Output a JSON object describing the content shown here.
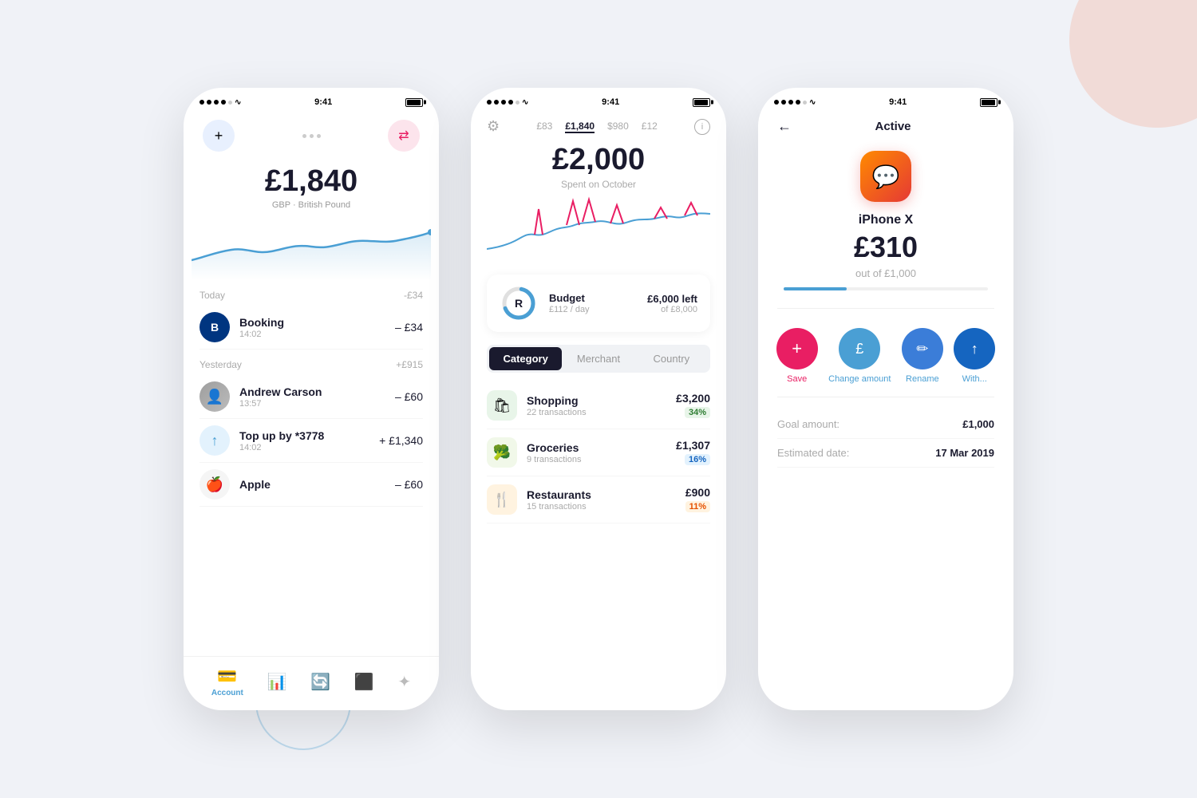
{
  "background": {
    "color": "#f0f2f7"
  },
  "phone1": {
    "status_bar": {
      "time": "9:41",
      "signal": "●●●●○",
      "wifi": "wifi"
    },
    "balance": "£1,840",
    "currency": "GBP · British Pound",
    "add_button": "+",
    "transfer_button": "⇄",
    "transactions": {
      "today_label": "Today",
      "today_amount": "-£34",
      "yesterday_label": "Yesterday",
      "yesterday_amount": "+£915",
      "items": [
        {
          "name": "Booking",
          "time": "14:02",
          "amount": "– £34",
          "avatar_text": "B",
          "avatar_type": "booking"
        },
        {
          "name": "Andrew Carson",
          "time": "13:57",
          "amount": "– £60",
          "avatar_text": "👤",
          "avatar_type": "andrew"
        },
        {
          "name": "Top up by *3778",
          "time": "14:02",
          "amount": "+ £1,340",
          "avatar_text": "↑",
          "avatar_type": "topup"
        },
        {
          "name": "Apple",
          "time": "",
          "amount": "– £60",
          "avatar_text": "🍎",
          "avatar_type": "apple"
        }
      ]
    },
    "nav": {
      "items": [
        {
          "icon": "💳",
          "label": "Account",
          "active": true
        },
        {
          "icon": "📊",
          "label": "",
          "active": false
        },
        {
          "icon": "🔄",
          "label": "",
          "active": false
        },
        {
          "icon": "⬛",
          "label": "",
          "active": false
        },
        {
          "icon": "✦",
          "label": "",
          "active": false
        }
      ]
    }
  },
  "phone2": {
    "status_bar": {
      "time": "9:41"
    },
    "header_tabs": [
      "£83",
      "£1,840",
      "$980",
      "£12"
    ],
    "balance": "£2,000",
    "balance_sub": "Spent on October",
    "budget": {
      "icon": "R",
      "label": "Budget",
      "sub": "£112 / day",
      "left": "£6,000 left",
      "of": "of £8,000"
    },
    "segment_tabs": [
      "Category",
      "Merchant",
      "Country"
    ],
    "active_tab": "Category",
    "categories": [
      {
        "icon": "🛍",
        "type": "shopping",
        "name": "Shopping",
        "count": "22 transactions",
        "amount": "£3,200",
        "pct": "34%",
        "pct_type": "green"
      },
      {
        "icon": "🥦",
        "type": "groceries",
        "name": "Groceries",
        "count": "9 transactions",
        "amount": "£1,307",
        "pct": "16%",
        "pct_type": "blue"
      },
      {
        "icon": "🍴",
        "type": "restaurants",
        "name": "Restaurants",
        "count": "15 transactions",
        "amount": "£900",
        "pct": "11%",
        "pct_type": "orange"
      }
    ]
  },
  "phone3": {
    "status_bar": {
      "time": "9:41"
    },
    "back_label": "←",
    "title": "Active",
    "goal": {
      "icon": "💬",
      "name": "iPhone X",
      "amount": "£310",
      "out_of": "out of £1,000",
      "progress_pct": 31
    },
    "actions": [
      {
        "icon": "+",
        "label": "Save",
        "color": "pink"
      },
      {
        "icon": "₤",
        "label": "Change amount",
        "color": "blue-med"
      },
      {
        "icon": "✏",
        "label": "Rename",
        "color": "blue-dark"
      },
      {
        "icon": "↑",
        "label": "With...",
        "color": "blue-darker"
      }
    ],
    "details": [
      {
        "label": "Goal amount:",
        "value": "£1,000"
      },
      {
        "label": "Estimated date:",
        "value": "17 Mar 2019"
      }
    ]
  }
}
